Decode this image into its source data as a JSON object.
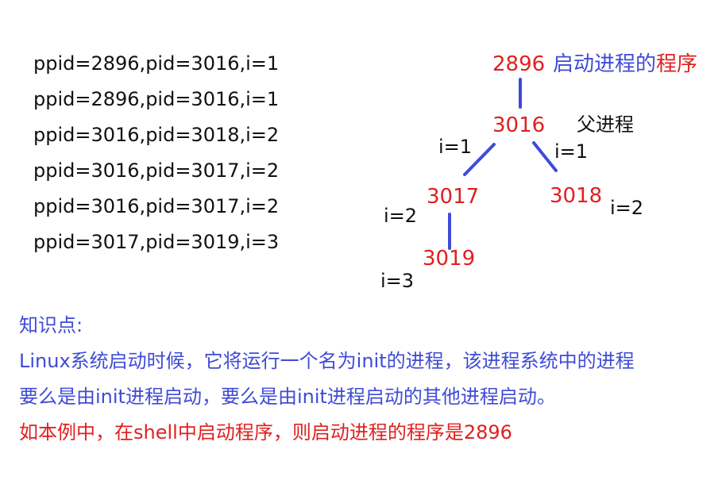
{
  "log_lines": [
    "ppid=2896,pid=3016,i=1",
    "ppid=2896,pid=3016,i=1",
    "ppid=3016,pid=3018,i=2",
    "ppid=3016,pid=3017,i=2",
    "ppid=3016,pid=3017,i=2",
    "ppid=3017,pid=3019,i=3"
  ],
  "tree": {
    "root_pid": "2896",
    "root_note_blue": "启动进程的",
    "root_note_red": "程序",
    "parent_pid": "3016",
    "parent_note": "父进程",
    "left_edge_label": "i=1",
    "right_edge_label": "i=1",
    "child_left_pid": "3017",
    "child_left_label": "i=2",
    "child_right_pid": "3018",
    "child_right_label": "i=2",
    "grandchild_pid": "3019",
    "grandchild_label": "i=3"
  },
  "notes": {
    "heading": "知识点:",
    "line1": "Linux系统启动时候，它将运行一个名为init的进程，该进程系统中的进程",
    "line2": "要么是由init进程启动，要么是由init进程启动的其他进程启动。",
    "line3": "如本例中，在shell中启动程序，则启动进程的程序是2896"
  },
  "colors": {
    "pid_red": "#e02020",
    "note_blue": "#3f4bd6",
    "edge_blue": "#3f4bd6",
    "text_black": "#111111"
  }
}
